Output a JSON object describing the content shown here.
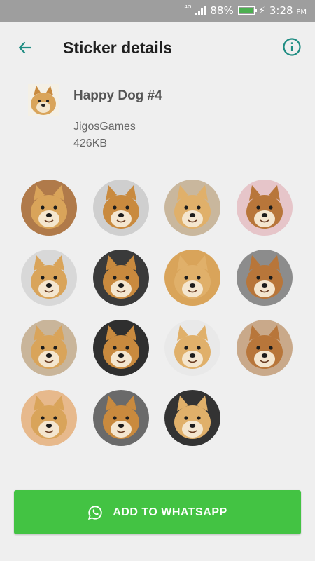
{
  "status_bar": {
    "network": "4G",
    "battery_pct": "88%",
    "battery_level": 0.88,
    "time": "3:28",
    "ampm": "PM"
  },
  "app_bar": {
    "title": "Sticker details",
    "back_icon": "arrow-left-icon",
    "info_icon": "info-icon"
  },
  "pack": {
    "name": "Happy Dog #4",
    "publisher": "JigosGames",
    "size": "426KB"
  },
  "stickers": [
    {
      "subject": "shiba-with-red-cup",
      "bg": "#b07a4a"
    },
    {
      "subject": "shiba-in-suit",
      "bg": "#cfcfcf"
    },
    {
      "subject": "shiba-in-japan-jersey",
      "bg": "#c9b79d"
    },
    {
      "subject": "shiba-in-yellow-shirt",
      "bg": "#e6c5c9"
    },
    {
      "subject": "shiba-with-sunglasses-grey",
      "bg": "#d8d8d8"
    },
    {
      "subject": "shiba-with-sunglasses",
      "bg": "#3a3a3a"
    },
    {
      "subject": "shiba-face-closeup",
      "bg": "#d9a45a"
    },
    {
      "subject": "shiba-black-tan",
      "bg": "#8c8c8c"
    },
    {
      "subject": "shiba-smiling",
      "bg": "#c9b59a"
    },
    {
      "subject": "shiba-white-bg",
      "bg": "#2f2f2f"
    },
    {
      "subject": "shiba-sleeping-curled",
      "bg": "#e9e9e9"
    },
    {
      "subject": "shiba-on-red-blanket",
      "bg": "#c9a98a"
    },
    {
      "subject": "shiba-on-bed",
      "bg": "#e7b98c"
    },
    {
      "subject": "shiba-with-pillow",
      "bg": "#6a6a6a"
    },
    {
      "subject": "shiba-with-dango",
      "bg": "#333333"
    }
  ],
  "add_button": {
    "label": "ADD TO WHATSAPP",
    "icon": "whatsapp-icon"
  },
  "colors": {
    "accent": "#1e8c82",
    "button": "#43c343",
    "background": "#efefef"
  }
}
